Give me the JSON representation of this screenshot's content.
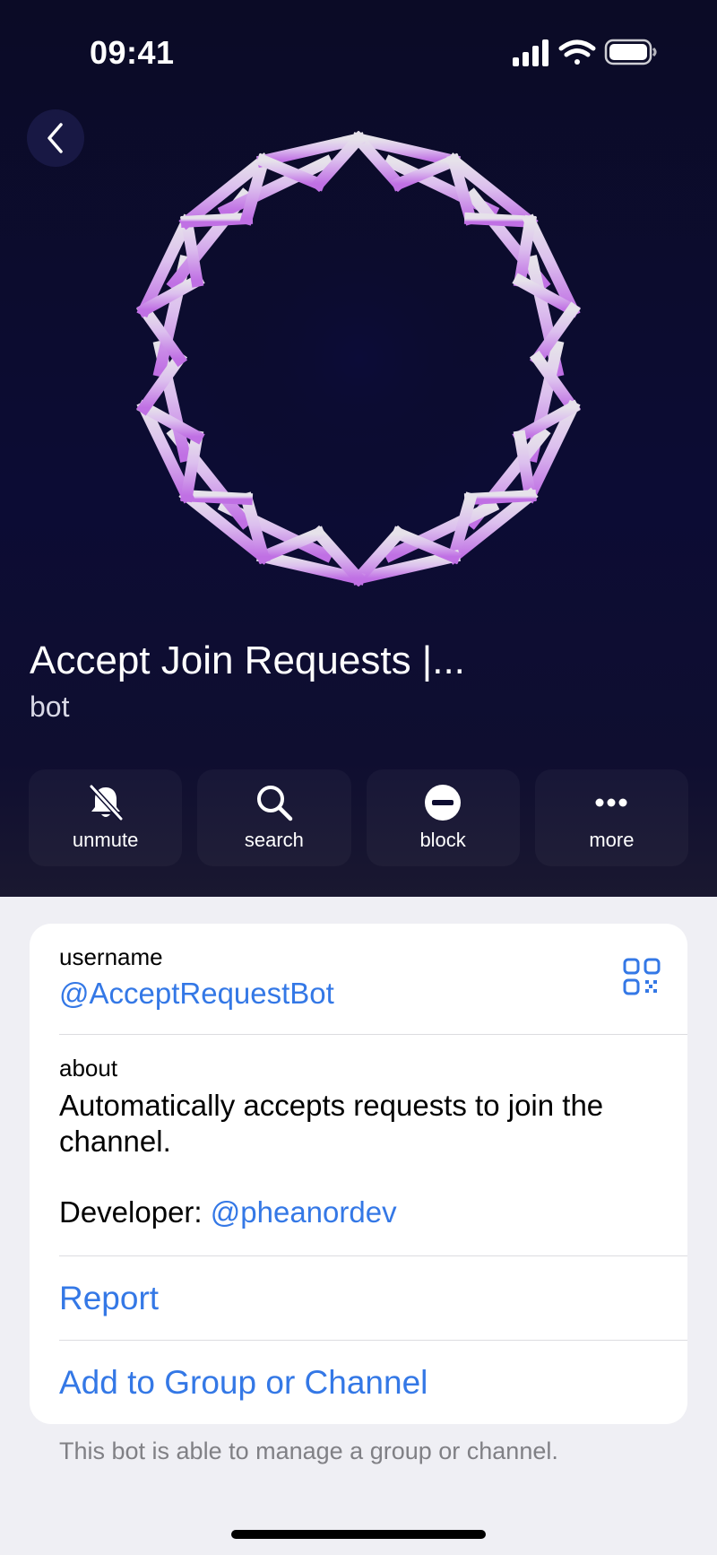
{
  "status_bar": {
    "time": "09:41"
  },
  "profile": {
    "name": "Accept Join Requests |...",
    "subtitle": "bot"
  },
  "actions": [
    {
      "label": "unmute",
      "icon": "bell-slash-icon"
    },
    {
      "label": "search",
      "icon": "search-icon"
    },
    {
      "label": "block",
      "icon": "block-icon"
    },
    {
      "label": "more",
      "icon": "more-icon"
    }
  ],
  "info": {
    "username_label": "username",
    "username_value": "@AcceptRequestBot",
    "about_label": "about",
    "about_text": "Automatically accepts requests to join the channel.",
    "developer_prefix": "Developer: ",
    "developer_handle": "@pheanordev"
  },
  "menu": {
    "report": "Report",
    "add_to_group": "Add to Group or Channel"
  },
  "footer_note": "This bot is able to manage a group or channel.",
  "colors": {
    "accent": "#3478e6",
    "header_bg": "#0c0c34",
    "avatar_top": "#e8e4ec",
    "avatar_bottom": "#c474e6"
  }
}
